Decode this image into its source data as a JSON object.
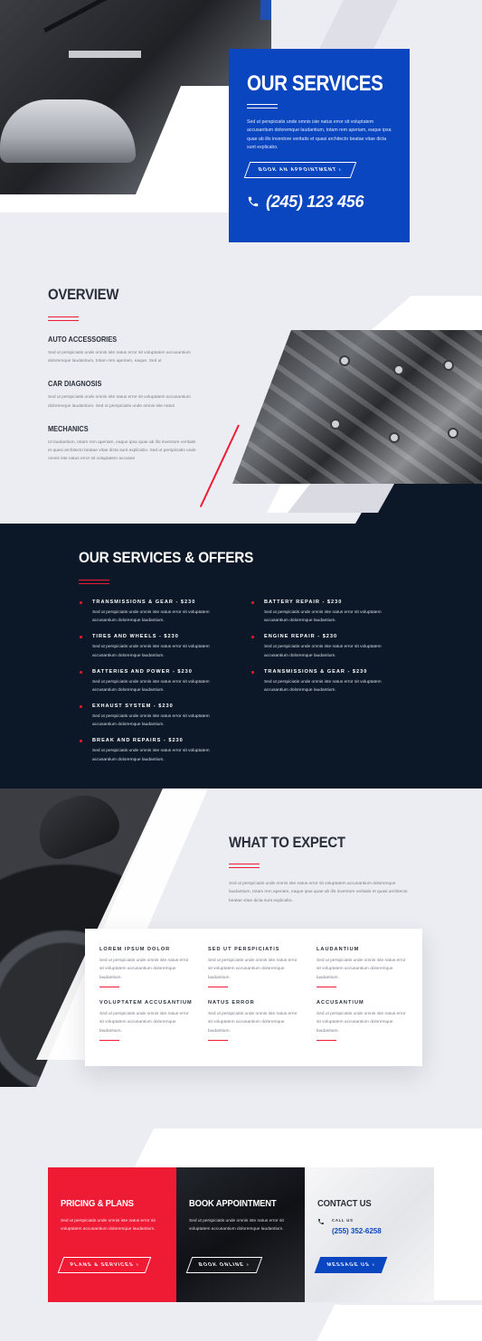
{
  "hero": {
    "title": "OUR SERVICES",
    "text": "Sed ut perspiciatis unde omnis iste natus error sit voluptatem accusantium doloremque laudantium, totam rem aperiam, eaque ipsa quae ab illo inventore veritatis et quasi architecto beatae vitae dicta sunt explicabo.",
    "button_label": "BOOK AN APPOINTMENT",
    "button_arrow": "›",
    "phone": "(245) 123 456",
    "phone_icon": "phone-icon"
  },
  "overview": {
    "title": "OVERVIEW",
    "items": [
      {
        "title": "AUTO ACCESSORIES",
        "text": "Sed ut perspiciatis unde omnis iste natus error sit voluptatem accusantium doloremque laudantium, totam rem aperiam, eaque. Sed ut"
      },
      {
        "title": "CAR DIAGNOSIS",
        "text": "Sed ut perspiciatis unde omnis iste natus error sit voluptatem accusantium doloremque laudantium. Sed ut perspiciatis unde omnis iste natus"
      },
      {
        "title": "MECHANICS",
        "text": "Ut laudantium, totam rem aperiam, eaque ipsa quae ab illo inventore veritatis et quasi architecto beatae vitae dicta sunt explicabo. Sed ut perspiciatis unde omnis iste natus error sit voluptatem accusan"
      }
    ]
  },
  "offers": {
    "title": "OUR SERVICES & OFFERS",
    "col1": [
      {
        "title": "TRANSMISSIONS & GEAR - $230",
        "text": "Sed ut perspiciatis unde omnis iste natus error sit voluptatem accusantium doloremque laudantium."
      },
      {
        "title": "TIRES AND WHEELS - $230",
        "text": "Sed ut perspiciatis unde omnis iste natus error sit voluptatem accusantium doloremque laudantium."
      },
      {
        "title": "BATTERIES AND POWER - $230",
        "text": "Sed ut perspiciatis unde omnis iste natus error sit voluptatem accusantium doloremque laudantium."
      },
      {
        "title": "EXHAUST SYSTEM - $230",
        "text": "Sed ut perspiciatis unde omnis iste natus error sit voluptatem accusantium doloremque laudantium."
      },
      {
        "title": "BREAK AND REPAIRS - $230",
        "text": "Sed ut perspiciatis unde omnis iste natus error sit voluptatem accusantium doloremque laudantium."
      }
    ],
    "col2": [
      {
        "title": "BATTERY REPAIR - $230",
        "text": "Sed ut perspiciatis unde omnis iste natus error sit voluptatem accusantium doloremque laudantium."
      },
      {
        "title": "ENGINE REPAIR - $230",
        "text": "Sed ut perspiciatis unde omnis iste natus error sit voluptatem accusantium doloremque laudantium."
      },
      {
        "title": "TRANSMISSIONS & GEAR - $230",
        "text": "Sed ut perspiciatis unde omnis iste natus error sit voluptatem accusantium doloremque laudantium."
      }
    ]
  },
  "expect": {
    "title": "WHAT TO EXPECT",
    "intro": "Sed ut perspiciatis unde omnis iste natus error sit voluptatem accusantium doloremque laudantium, totam rem aperiam, eaque ipsa quae ab illo inventore veritatis et quasi architecto beatae vitae dicta sunt explicabo.",
    "cells": [
      {
        "title": "LOREM IPSUM DOLOR",
        "text": "Sed ut perspiciatis unde omnis iste natus error sit voluptatem accusantium doloremque laudantium."
      },
      {
        "title": "SED UT PERSPICIATIS",
        "text": "Sed ut perspiciatis unde omnis iste natus error sit voluptatem accusantium doloremque laudantium."
      },
      {
        "title": "LAUDANTIUM",
        "text": "Sed ut perspiciatis unde omnis iste natus error sit voluptatem accusantium doloremque laudantium."
      },
      {
        "title": "VOLUPTATEM ACCUSANTIUM",
        "text": "Sed ut perspiciatis unde omnis iste natus error sit voluptatem accusantium doloremque laudantium."
      },
      {
        "title": "NATUS ERROR",
        "text": "Sed ut perspiciatis unde omnis iste natus error sit voluptatem accusantium doloremque laudantium."
      },
      {
        "title": "ACCUSANTIUM",
        "text": "Sed ut perspiciatis unde omnis iste natus error sit voluptatem accusantium doloremque laudantium."
      }
    ]
  },
  "cta": {
    "pricing": {
      "title": "PRICING & PLANS",
      "text": "Sed ut perspiciatis unde omnis iste natus error sit voluptatem accusantium doloremque laudantium.",
      "button_label": "PLANS & SERVICES",
      "button_arrow": "›"
    },
    "booking": {
      "title": "BOOK APPOINTMENT",
      "text": "Sed ut perspiciatis unde omnis iste natus error sit voluptatem accusantium doloremque laudantium.",
      "button_label": "BOOK ONLINE",
      "button_arrow": "›"
    },
    "contact": {
      "title": "CONTACT US",
      "call_label": "CALL US",
      "phone": "(255) 352-6258",
      "button_label": "MESSAGE US",
      "button_arrow": "›"
    }
  },
  "colors": {
    "brand_blue": "#0b46c1",
    "accent_red": "#ef1b35",
    "navy": "#0c1828",
    "bg": "#ecedf2"
  }
}
